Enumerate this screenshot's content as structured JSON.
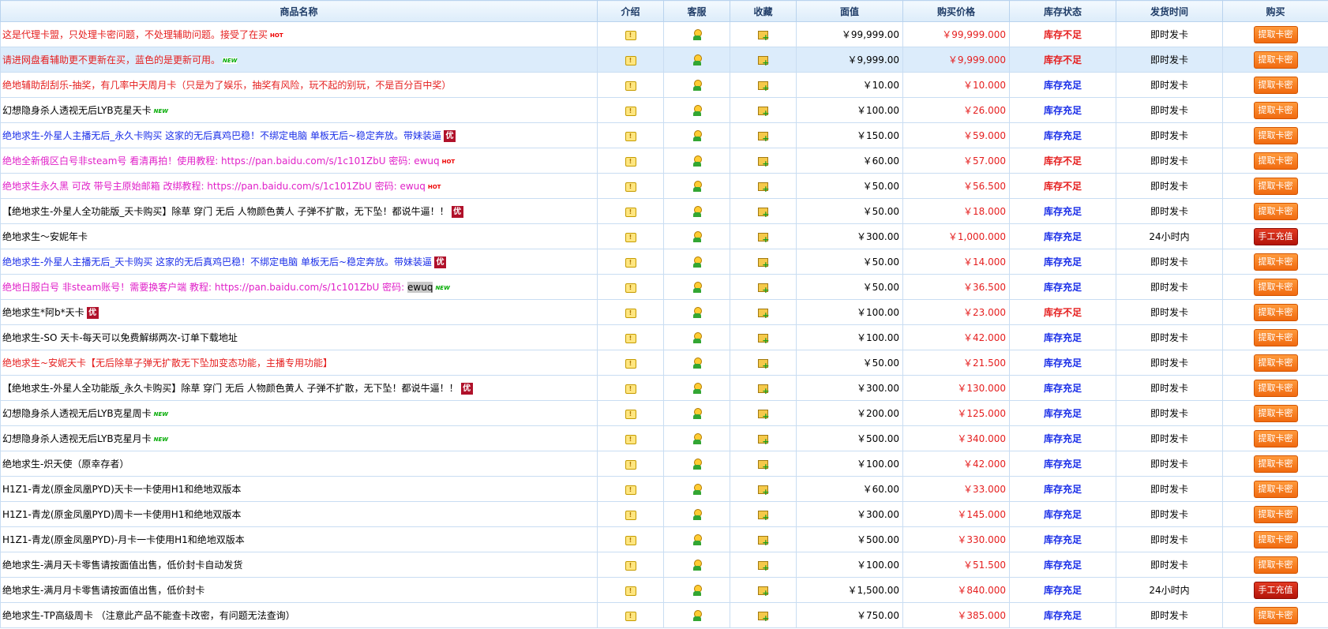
{
  "columns": [
    "商品名称",
    "介绍",
    "客服",
    "收藏",
    "面值",
    "购买价格",
    "库存状态",
    "发货时间",
    "购买"
  ],
  "icons": {
    "intro": "notice-icon",
    "cs": "customer-service-icon",
    "fav": "add-favorite-icon"
  },
  "rows": [
    {
      "name": "这是代理卡盟，只处理卡密问题，不处理辅助问题。接受了在买",
      "color": "red",
      "badge": "HOT",
      "face": "￥99,999.00",
      "price": "￥99,999.000",
      "stock": "库存不足",
      "stock_low": true,
      "ship": "即时发卡",
      "btn": "提取卡密",
      "manual": false
    },
    {
      "name": "请进网盘看辅助更不更新在买，蓝色的是更新可用。",
      "color": "red",
      "badge": "NEW",
      "face": "￥9,999.00",
      "price": "￥9,999.000",
      "stock": "库存不足",
      "stock_low": true,
      "ship": "即时发卡",
      "btn": "提取卡密",
      "manual": false,
      "highlight": true
    },
    {
      "name": "绝地辅助刮刮乐-抽奖，有几率中天周月卡（只是为了娱乐，抽奖有风险，玩不起的别玩，不是百分百中奖）",
      "color": "red",
      "badge": "",
      "face": "￥10.00",
      "price": "￥10.000",
      "stock": "库存充足",
      "stock_low": false,
      "ship": "即时发卡",
      "btn": "提取卡密",
      "manual": false
    },
    {
      "name": "幻想隐身杀人透视无后LYB克星天卡",
      "color": "black",
      "badge": "NEW",
      "face": "￥100.00",
      "price": "￥26.000",
      "stock": "库存充足",
      "stock_low": false,
      "ship": "即时发卡",
      "btn": "提取卡密",
      "manual": false
    },
    {
      "name": "绝地求生-外星人主播无后_永久卡购买 这家的无后真鸡巴稳！不绑定电脑 单板无后~稳定奔放。带妹装逼",
      "color": "blue",
      "badge": "优",
      "face": "￥150.00",
      "price": "￥59.000",
      "stock": "库存充足",
      "stock_low": false,
      "ship": "即时发卡",
      "btn": "提取卡密",
      "manual": false
    },
    {
      "name": "绝地全新俄区白号非steam号 看清再拍！使用教程: https://pan.baidu.com/s/1c101ZbU 密码: ewuq",
      "color": "mag",
      "badge": "HOT",
      "face": "￥60.00",
      "price": "￥57.000",
      "stock": "库存不足",
      "stock_low": true,
      "ship": "即时发卡",
      "btn": "提取卡密",
      "manual": false
    },
    {
      "name": "绝地求生永久黑 可改 带号主原始邮箱 改绑教程: https://pan.baidu.com/s/1c101ZbU 密码: ewuq",
      "color": "mag",
      "badge": "HOT",
      "face": "￥50.00",
      "price": "￥56.500",
      "stock": "库存不足",
      "stock_low": true,
      "ship": "即时发卡",
      "btn": "提取卡密",
      "manual": false
    },
    {
      "name": "【绝地求生-外星人全功能版_天卡购买】除草 穿门 无后 人物颜色黄人 子弹不扩散，无下坠！都说牛逼！！",
      "color": "black",
      "badge": "优",
      "face": "￥50.00",
      "price": "￥18.000",
      "stock": "库存充足",
      "stock_low": false,
      "ship": "即时发卡",
      "btn": "提取卡密",
      "manual": false
    },
    {
      "name": "绝地求生～安妮年卡",
      "color": "black",
      "badge": "",
      "face": "￥300.00",
      "price": "￥1,000.000",
      "stock": "库存充足",
      "stock_low": false,
      "ship": "24小时内",
      "btn": "手工充值",
      "manual": true
    },
    {
      "name": "绝地求生-外星人主播无后_天卡购买 这家的无后真鸡巴稳！不绑定电脑 单板无后~稳定奔放。带妹装逼",
      "color": "blue",
      "badge": "优",
      "face": "￥50.00",
      "price": "￥14.000",
      "stock": "库存充足",
      "stock_low": false,
      "ship": "即时发卡",
      "btn": "提取卡密",
      "manual": false
    },
    {
      "name": "绝地日服白号 非steam账号！需要换客户端 教程: https://pan.baidu.com/s/1c101ZbU 密码: ",
      "name_hl": "ewuq",
      "color": "mag",
      "badge": "NEW",
      "face": "￥50.00",
      "price": "￥36.500",
      "stock": "库存充足",
      "stock_low": false,
      "ship": "即时发卡",
      "btn": "提取卡密",
      "manual": false
    },
    {
      "name": "绝地求生*阿b*天卡",
      "color": "black",
      "badge": "优",
      "face": "￥100.00",
      "price": "￥23.000",
      "stock": "库存不足",
      "stock_low": true,
      "ship": "即时发卡",
      "btn": "提取卡密",
      "manual": false
    },
    {
      "name": "绝地求生-SO 天卡-每天可以免费解绑两次-订单下载地址",
      "color": "black",
      "badge": "",
      "face": "￥100.00",
      "price": "￥42.000",
      "stock": "库存充足",
      "stock_low": false,
      "ship": "即时发卡",
      "btn": "提取卡密",
      "manual": false
    },
    {
      "name": "绝地求生~安妮天卡【无后除草子弹无扩散无下坠加变态功能，主播专用功能】",
      "color": "red",
      "badge": "",
      "face": "￥50.00",
      "price": "￥21.500",
      "stock": "库存充足",
      "stock_low": false,
      "ship": "即时发卡",
      "btn": "提取卡密",
      "manual": false
    },
    {
      "name": "【绝地求生-外星人全功能版_永久卡购买】除草 穿门 无后 人物颜色黄人 子弹不扩散，无下坠！都说牛逼！！",
      "color": "black",
      "badge": "优",
      "face": "￥300.00",
      "price": "￥130.000",
      "stock": "库存充足",
      "stock_low": false,
      "ship": "即时发卡",
      "btn": "提取卡密",
      "manual": false
    },
    {
      "name": "幻想隐身杀人透视无后LYB克星周卡",
      "color": "black",
      "badge": "NEW",
      "face": "￥200.00",
      "price": "￥125.000",
      "stock": "库存充足",
      "stock_low": false,
      "ship": "即时发卡",
      "btn": "提取卡密",
      "manual": false
    },
    {
      "name": "幻想隐身杀人透视无后LYB克星月卡",
      "color": "black",
      "badge": "NEW",
      "face": "￥500.00",
      "price": "￥340.000",
      "stock": "库存充足",
      "stock_low": false,
      "ship": "即时发卡",
      "btn": "提取卡密",
      "manual": false
    },
    {
      "name": "绝地求生-炽天使（原幸存者）",
      "color": "black",
      "badge": "",
      "face": "￥100.00",
      "price": "￥42.000",
      "stock": "库存充足",
      "stock_low": false,
      "ship": "即时发卡",
      "btn": "提取卡密",
      "manual": false
    },
    {
      "name": "H1Z1-青龙(原金凤凰PYD)天卡一卡使用H1和绝地双版本",
      "color": "black",
      "badge": "",
      "face": "￥60.00",
      "price": "￥33.000",
      "stock": "库存充足",
      "stock_low": false,
      "ship": "即时发卡",
      "btn": "提取卡密",
      "manual": false
    },
    {
      "name": "H1Z1-青龙(原金凤凰PYD)周卡一卡使用H1和绝地双版本",
      "color": "black",
      "badge": "",
      "face": "￥300.00",
      "price": "￥145.000",
      "stock": "库存充足",
      "stock_low": false,
      "ship": "即时发卡",
      "btn": "提取卡密",
      "manual": false
    },
    {
      "name": "H1Z1-青龙(原金凤凰PYD)-月卡一卡使用H1和绝地双版本",
      "color": "black",
      "badge": "",
      "face": "￥500.00",
      "price": "￥330.000",
      "stock": "库存充足",
      "stock_low": false,
      "ship": "即时发卡",
      "btn": "提取卡密",
      "manual": false
    },
    {
      "name": "绝地求生-满月天卡零售请按面值出售，低价封卡自动发货",
      "color": "black",
      "badge": "",
      "face": "￥100.00",
      "price": "￥51.500",
      "stock": "库存充足",
      "stock_low": false,
      "ship": "即时发卡",
      "btn": "提取卡密",
      "manual": false
    },
    {
      "name": "绝地求生-满月月卡零售请按面值出售，低价封卡",
      "color": "black",
      "badge": "",
      "face": "￥1,500.00",
      "price": "￥840.000",
      "stock": "库存充足",
      "stock_low": false,
      "ship": "24小时内",
      "btn": "手工充值",
      "manual": true
    },
    {
      "name": "绝地求生-TP高级周卡 （注意此产品不能查卡改密，有问题无法查询）",
      "color": "black",
      "badge": "",
      "face": "￥750.00",
      "price": "￥385.000",
      "stock": "库存充足",
      "stock_low": false,
      "ship": "即时发卡",
      "btn": "提取卡密",
      "manual": false
    }
  ]
}
